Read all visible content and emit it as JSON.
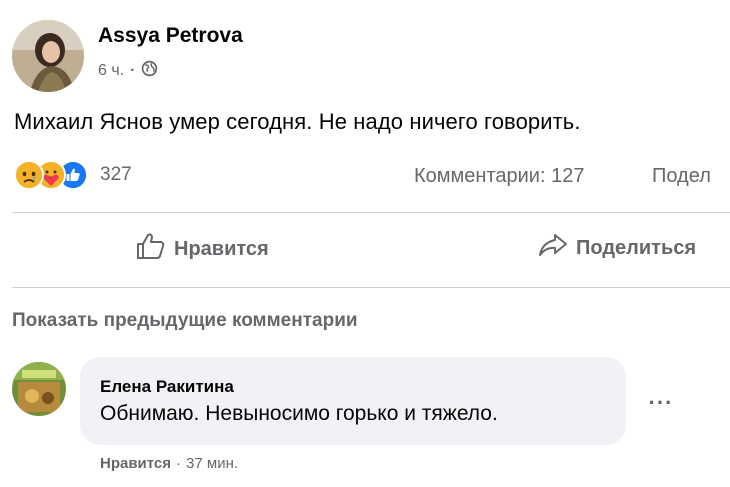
{
  "post": {
    "author": "Assya Petrova",
    "time": "6 ч.",
    "separator": "·",
    "text": "Михаил Яснов умер сегодня. Не надо ничего говорить.",
    "reactions": [
      "sad",
      "care",
      "like"
    ],
    "reaction_count": "327",
    "comments_count": "Комментарии: 127",
    "shares_truncated": "Подел"
  },
  "actions": {
    "like_label": "Нравится",
    "share_label": "Поделиться"
  },
  "comments_section": {
    "show_previous": "Показать предыдущие комментарии",
    "comment": {
      "author": "Елена Ракитина",
      "text": "Обнимаю. Невыносимо горько и тяжело.",
      "like_label": "Нравится",
      "separator": "·",
      "time": "37 мин.",
      "more_icon": "ellipsis-icon"
    }
  },
  "colors": {
    "text_primary": "#050505",
    "text_secondary": "#65676b",
    "bubble_bg": "#f0f2f5",
    "divider": "#ced0d4",
    "like_blue": "#1877f2"
  }
}
